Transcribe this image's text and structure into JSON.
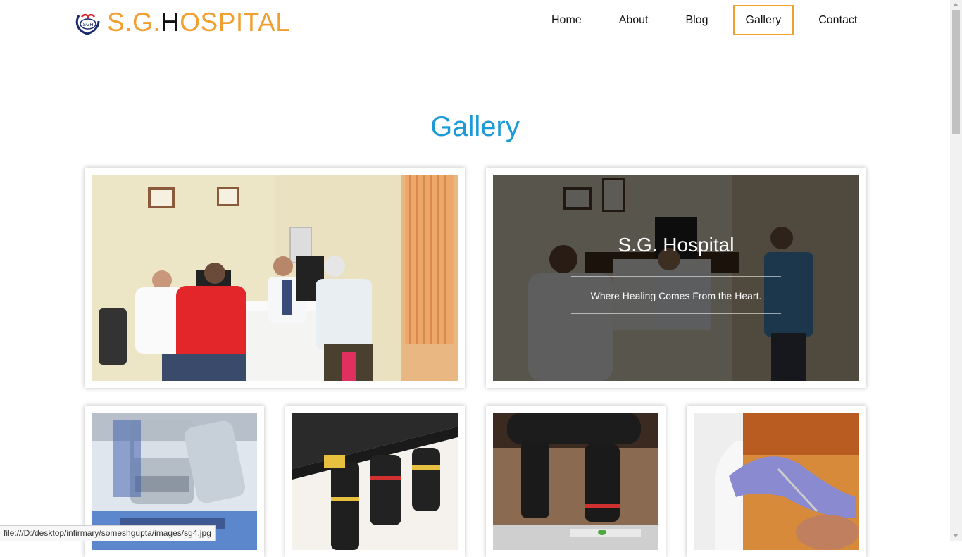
{
  "brand": {
    "logo_initials": "SGH",
    "name_part1": "S.G.",
    "name_part2": "H",
    "name_part3": "OSPITAL",
    "accent_color": "#f0a030",
    "title_color": "#1a9ad6"
  },
  "nav": {
    "items": [
      {
        "label": "Home",
        "active": false
      },
      {
        "label": "About",
        "active": false
      },
      {
        "label": "Blog",
        "active": false
      },
      {
        "label": "Gallery",
        "active": true
      },
      {
        "label": "Contact",
        "active": false
      }
    ]
  },
  "page": {
    "title": "Gallery"
  },
  "gallery": {
    "images": [
      {
        "name": "doctor-consultation-photo"
      },
      {
        "name": "consultation-room-photo",
        "overlay_title": "S.G. Hospital",
        "overlay_subtitle": "Where Healing Comes From the Heart."
      },
      {
        "name": "microscope-photo-1"
      },
      {
        "name": "microscope-photo-2"
      },
      {
        "name": "microscope-photo-3"
      },
      {
        "name": "dental-procedure-photo"
      }
    ]
  },
  "status_bar": {
    "url": "file:///D:/desktop/infirmary/someshgupta/images/sg4.jpg"
  }
}
